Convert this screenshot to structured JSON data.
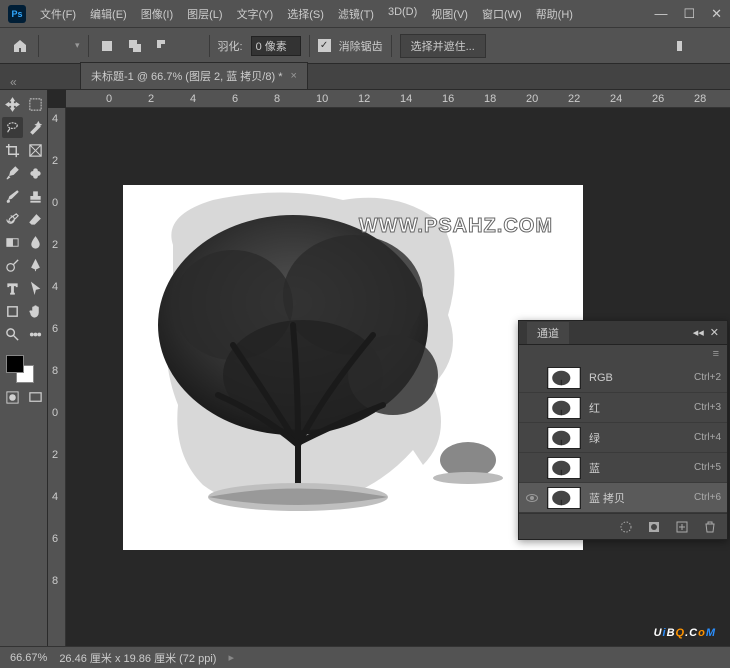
{
  "menu": [
    "文件(F)",
    "编辑(E)",
    "图像(I)",
    "图层(L)",
    "文字(Y)",
    "选择(S)",
    "滤镜(T)",
    "3D(D)",
    "视图(V)",
    "窗口(W)",
    "帮助(H)"
  ],
  "options": {
    "feather_label": "羽化:",
    "feather_value": "0 像素",
    "antialias": "消除锯齿",
    "mask_btn": "选择并遮住..."
  },
  "doc": {
    "title": "未标题-1 @ 66.7% (图层 2, 蓝 拷贝/8) *"
  },
  "ruler_h": [
    "0",
    "2",
    "4",
    "6",
    "8",
    "10",
    "12",
    "14",
    "16",
    "18",
    "20",
    "22",
    "24",
    "26",
    "28"
  ],
  "ruler_v": [
    "4",
    "2",
    "0",
    "2",
    "4",
    "6",
    "8",
    "0",
    "2",
    "4",
    "6",
    "8"
  ],
  "watermark": "WWW.PSAHZ.COM",
  "channels": {
    "title": "通道",
    "rows": [
      {
        "name": "RGB",
        "short": "Ctrl+2",
        "visible": false,
        "selected": false,
        "color": true
      },
      {
        "name": "红",
        "short": "Ctrl+3",
        "visible": false,
        "selected": false,
        "color": false
      },
      {
        "name": "绿",
        "short": "Ctrl+4",
        "visible": false,
        "selected": false,
        "color": false
      },
      {
        "name": "蓝",
        "short": "Ctrl+5",
        "visible": false,
        "selected": false,
        "color": false
      },
      {
        "name": "蓝 拷贝",
        "short": "Ctrl+6",
        "visible": true,
        "selected": true,
        "color": false
      }
    ]
  },
  "status": {
    "zoom": "66.67%",
    "dims": "26.46 厘米 x 19.86 厘米 (72 ppi)"
  },
  "brand": {
    "t": "UiBQ.CoM"
  }
}
